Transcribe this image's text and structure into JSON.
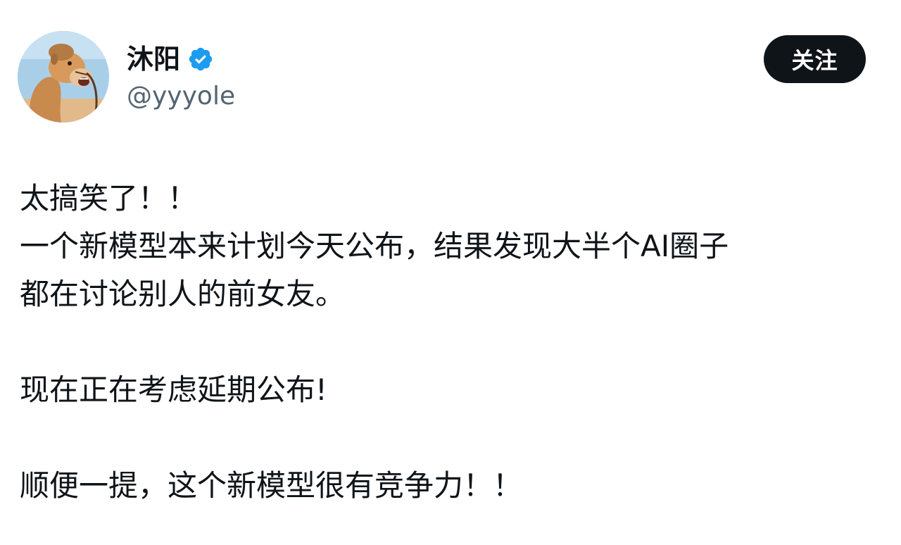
{
  "author": {
    "display_name": "沐阳",
    "handle": "@yyyole",
    "verified": true,
    "avatar_icon": "camel-avatar"
  },
  "actions": {
    "follow_label": "关注"
  },
  "tweet": {
    "lines": [
      "太搞笑了！！",
      "一个新模型本来计划今天公布，结果发现大半个AI圈子",
      "都在讨论别人的前女友。",
      "",
      "现在正在考虑延期公布!",
      "",
      "顺便一提，这个新模型很有竞争力！！"
    ]
  },
  "colors": {
    "text": "#0f1419",
    "secondary_text": "#536471",
    "verified_badge": "#1d9bf0",
    "button_bg": "#0f1419",
    "button_text": "#ffffff"
  }
}
